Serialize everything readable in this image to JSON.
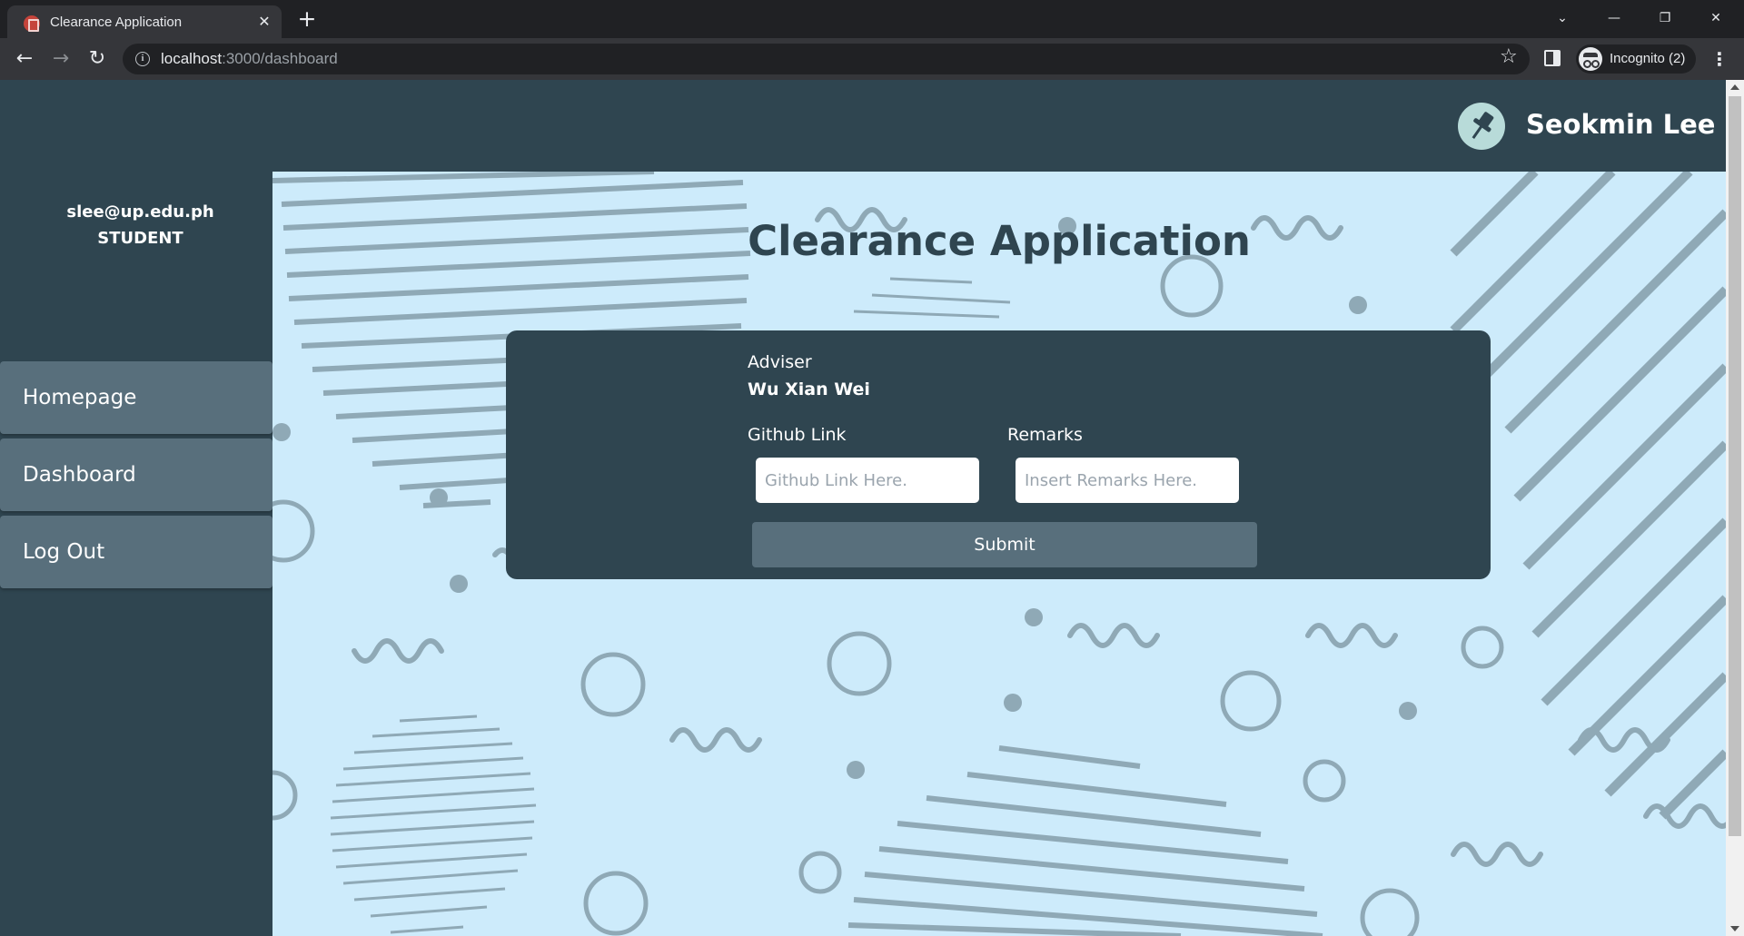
{
  "browser": {
    "tab_title": "Clearance Application",
    "tab_close": "✕",
    "new_tab": "+",
    "url_host": "localhost",
    "url_path": ":3000/dashboard",
    "incognito_label": "Incognito (2)",
    "window_controls": {
      "dropdown": "⌄",
      "minimize": "—",
      "restore": "❐",
      "close": "✕"
    },
    "nav": {
      "back": "←",
      "forward": "→",
      "reload": "↻"
    },
    "star": "☆",
    "menu": "⋮"
  },
  "header": {
    "user_name": "Seokmin Lee"
  },
  "sidebar": {
    "email": "slee@up.edu.ph",
    "role": "STUDENT",
    "items": [
      {
        "label": "Homepage"
      },
      {
        "label": "Dashboard"
      },
      {
        "label": "Log Out"
      }
    ]
  },
  "main": {
    "title": "Clearance Application",
    "form": {
      "adviser_label": "Adviser",
      "adviser_name": "Wu Xian Wei",
      "github_label": "Github Link",
      "github_placeholder": "Github Link Here.",
      "github_value": "",
      "remarks_label": "Remarks",
      "remarks_placeholder": "Insert Remarks Here.",
      "remarks_value": "",
      "submit_label": "Submit"
    }
  },
  "colors": {
    "header_bg": "#2f4550",
    "content_bg": "#cdebfb",
    "accent": "#586f7c",
    "logo_bg": "#b8dbd9",
    "decor": "#8fa9b6"
  },
  "icons": {
    "tab_favicon": "app-icon",
    "brand_logo": "pushpin-icon",
    "incognito": "incognito-icon"
  }
}
